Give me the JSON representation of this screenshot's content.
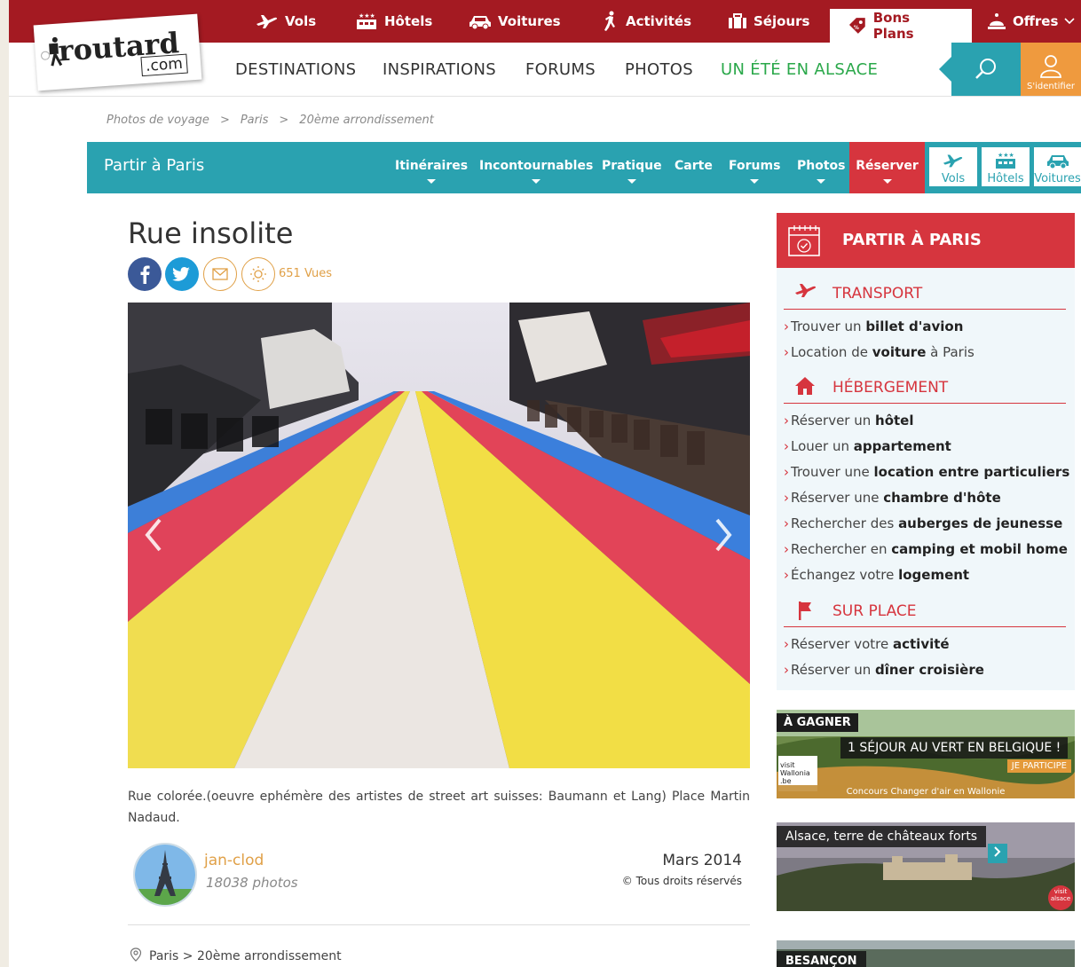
{
  "topbar": {
    "vols": "Vols",
    "hotels": "Hôtels",
    "voitures": "Voitures",
    "activites": "Activités",
    "sejours": "Séjours",
    "bons_plans": "Bons Plans",
    "offres": "Offres"
  },
  "logo": {
    "name": "routard",
    "com": ".com"
  },
  "mainnav": {
    "destinations": "DESTINATIONS",
    "inspirations": "INSPIRATIONS",
    "forums": "FORUMS",
    "photos": "PHOTOS",
    "alsace": "UN ÉTÉ EN ALSACE",
    "login": "S'identifier"
  },
  "breadcrumb": [
    "Photos de voyage",
    "Paris",
    "20ème arrondissement"
  ],
  "subnav": {
    "title": "Partir à Paris",
    "tabs": [
      "Itinéraires",
      "Incontournables",
      "Pratique",
      "Carte",
      "Forums",
      "Photos"
    ],
    "reserver": "Réserver",
    "quick": [
      "Vols",
      "Hôtels",
      "Voitures"
    ]
  },
  "article": {
    "title": "Rue insolite",
    "views": "651 Vues",
    "caption": "Rue colorée.(oeuvre ephémère des artistes de street art suisses: Baumann et Lang) Place Martin Nadaud.",
    "author": "jan-clod",
    "photo_count": "18038 photos",
    "date": "Mars 2014",
    "rights": "© Tous droits réservés",
    "location": "Paris > 20ème arrondissement"
  },
  "widget": {
    "title": "PARTIR À PARIS",
    "sections": [
      {
        "label": "TRANSPORT",
        "links": [
          {
            "pre": "Trouver un ",
            "bold": "billet d'avion",
            "post": ""
          },
          {
            "pre": "Location de ",
            "bold": "voiture",
            "post": " à Paris"
          }
        ]
      },
      {
        "label": "HÉBERGEMENT",
        "links": [
          {
            "pre": "Réserver un ",
            "bold": "hôtel",
            "post": ""
          },
          {
            "pre": "Louer un ",
            "bold": "appartement",
            "post": ""
          },
          {
            "pre": "Trouver une ",
            "bold": "location entre particuliers",
            "post": ""
          },
          {
            "pre": "Réserver une ",
            "bold": "chambre d'hôte",
            "post": ""
          },
          {
            "pre": "Rechercher des ",
            "bold": "auberges de jeunesse",
            "post": ""
          },
          {
            "pre": "Rechercher en ",
            "bold": "camping et mobil home",
            "post": ""
          },
          {
            "pre": "Échangez votre ",
            "bold": "logement",
            "post": ""
          }
        ]
      },
      {
        "label": "SUR PLACE",
        "links": [
          {
            "pre": "Réserver votre ",
            "bold": "activité",
            "post": ""
          },
          {
            "pre": "Réserver un ",
            "bold": "dîner croisière",
            "post": ""
          }
        ]
      }
    ]
  },
  "ads": {
    "ad1": {
      "badge": "À GAGNER",
      "headline": "1 SÉJOUR AU VERT EN BELGIQUE !",
      "cta": "JE PARTICIPE",
      "footer": "Concours Changer d'air en Wallonie",
      "brand": "visit Wallonia .be"
    },
    "ad2": {
      "headline": "Alsace, terre de châteaux forts",
      "brand": "visit alsace"
    },
    "ad3": {
      "headline": "BESANÇON"
    }
  },
  "colors": {
    "brand_red": "#a41a22",
    "teal": "#2aa2b0",
    "accent_red": "#d6353e",
    "orange": "#ef9a3e",
    "green": "#2aa84a",
    "facebook": "#3b5998",
    "twitter": "#1d9bd7"
  }
}
